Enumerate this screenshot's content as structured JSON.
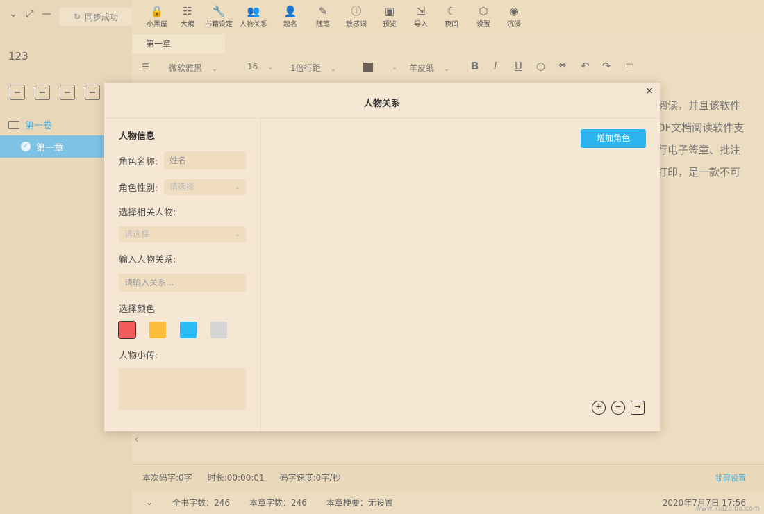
{
  "window": {
    "collapse_icon": "chevron-down",
    "fullscreen_icon": "expand",
    "minimize_icon": "minus"
  },
  "sidebar": {
    "sync_label": "同步成功",
    "book_title": "123",
    "tools": [
      "add-chapter-icon",
      "add-folder-icon",
      "export-icon",
      "delete-icon"
    ],
    "volume_label": "第一卷",
    "chapter_label": "第一章"
  },
  "toolbar": {
    "items": [
      {
        "label": "小黑屋",
        "icon": "lock-icon",
        "glyph": "🔒"
      },
      {
        "label": "大纲",
        "icon": "outline-icon",
        "glyph": "☷"
      },
      {
        "label": "书籍设定",
        "icon": "wrench-icon",
        "glyph": "🔧"
      },
      {
        "label": "人物关系",
        "icon": "people-icon",
        "glyph": "👥"
      },
      {
        "label": "起名",
        "icon": "person-icon",
        "glyph": "👤"
      },
      {
        "label": "随笔",
        "icon": "pen-icon",
        "glyph": "✎"
      },
      {
        "label": "敏感词",
        "icon": "alert-icon",
        "glyph": "ⓘ"
      },
      {
        "label": "预览",
        "icon": "preview-icon",
        "glyph": "▣"
      },
      {
        "label": "导入",
        "icon": "import-icon",
        "glyph": "⇲"
      },
      {
        "label": "夜间",
        "icon": "moon-icon",
        "glyph": "☾"
      },
      {
        "label": "设置",
        "icon": "settings-icon",
        "glyph": "⬡"
      },
      {
        "label": "沉浸",
        "icon": "immersive-icon",
        "glyph": "◉"
      }
    ]
  },
  "editor": {
    "tab_label": "第一章",
    "font_family": "微软雅黑",
    "font_size": "16",
    "line_spacing": "1倍行距",
    "text_color": "#6b6057",
    "background_theme": "羊皮纸",
    "text_lines": [
      "阅读，并且该软件",
      "DF文档阅读软件支",
      "行电子签章、批注",
      "打印，是一款不可"
    ]
  },
  "status": {
    "session_chars": "本次码字:0字",
    "duration": "时长:00:00:01",
    "speed": "码字速度:0字/秒",
    "link": "锁屏设置",
    "total_chars": "全书字数：246",
    "chapter_chars": "本章字数：246",
    "chapter_summary": "本章梗要：无设置",
    "datetime": "2020年7月7日 17:56",
    "watermark": "www.xiazaiba.com"
  },
  "modal": {
    "title": "人物关系",
    "close_symbol": "×",
    "left": {
      "heading": "人物信息",
      "name_label": "角色名称:",
      "name_placeholder": "姓名",
      "gender_label": "角色性别:",
      "gender_placeholder": "请选择",
      "related_label": "选择相关人物:",
      "related_placeholder": "请选择",
      "relation_label": "输入人物关系:",
      "relation_placeholder": "请输入关系...",
      "color_label": "选择颜色",
      "colors": [
        "#f25b5b",
        "#fbbd3c",
        "#2bbcf5",
        "#d6d6d6"
      ],
      "selected_color": "#f25b5b",
      "bio_label": "人物小传:"
    },
    "right": {
      "add_role_label": "增加角色",
      "zoom_in_icon": "zoom-in",
      "zoom_out_icon": "zoom-out",
      "export_icon": "export"
    }
  }
}
